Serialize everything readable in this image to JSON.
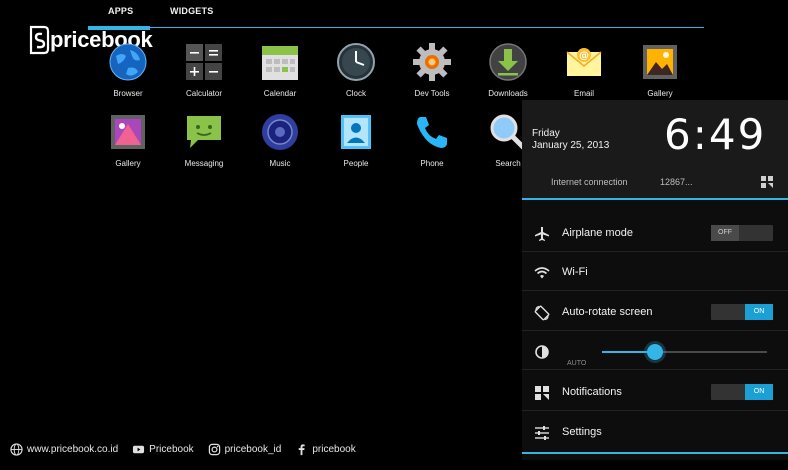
{
  "tabs": {
    "apps": "APPS",
    "widgets": "WIDGETS"
  },
  "logo": {
    "text": "pricebook"
  },
  "apps": [
    {
      "label": "Browser",
      "icon": "globe-icon"
    },
    {
      "label": "Calculator",
      "icon": "calculator-icon"
    },
    {
      "label": "Calendar",
      "icon": "calendar-icon"
    },
    {
      "label": "Clock",
      "icon": "clock-icon"
    },
    {
      "label": "Dev Tools",
      "icon": "gear-icon"
    },
    {
      "label": "Downloads",
      "icon": "download-icon"
    },
    {
      "label": "Email",
      "icon": "envelope-icon"
    },
    {
      "label": "Gallery",
      "icon": "picture-icon"
    },
    {
      "label": "Gallery",
      "icon": "picture-icon"
    },
    {
      "label": "Messaging",
      "icon": "message-icon"
    },
    {
      "label": "Music",
      "icon": "speaker-icon"
    },
    {
      "label": "People",
      "icon": "contact-icon"
    },
    {
      "label": "Phone",
      "icon": "phone-icon"
    },
    {
      "label": "Search",
      "icon": "magnifier-icon"
    }
  ],
  "panel": {
    "day": "Friday",
    "date": "January 25, 2013",
    "time": "6:49",
    "network": "Internet connection",
    "network_num": "12867...",
    "rows": {
      "airplane": {
        "label": "Airplane mode",
        "state": "OFF"
      },
      "wifi": {
        "label": "Wi-Fi"
      },
      "rotate": {
        "label": "Auto-rotate screen",
        "state": "ON"
      },
      "brightness": {
        "auto": "AUTO",
        "level": 0.32
      },
      "notifications": {
        "label": "Notifications",
        "state": "ON"
      },
      "settings": {
        "label": "Settings"
      }
    }
  },
  "footer": {
    "website": "www.pricebook.co.id",
    "youtube": "Pricebook",
    "instagram": "pricebook_id",
    "facebook": "pricebook"
  },
  "colors": {
    "accent": "#33b5e5",
    "toggle_on": "#1ba0d6",
    "background": "#000000"
  }
}
